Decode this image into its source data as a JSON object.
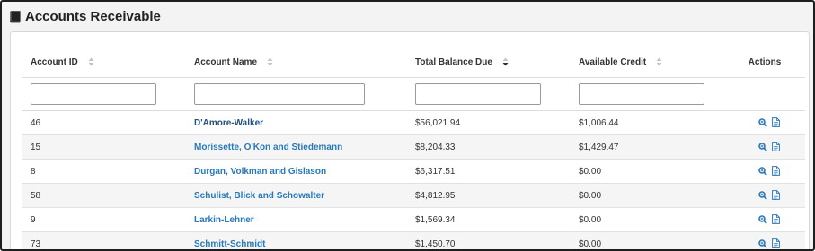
{
  "header": {
    "title": "Accounts Receivable",
    "icon": "book-icon"
  },
  "table": {
    "columns": [
      {
        "label": "Account ID",
        "sort": "unsorted"
      },
      {
        "label": "Account Name",
        "sort": "unsorted"
      },
      {
        "label": "Total Balance Due",
        "sort": "descending"
      },
      {
        "label": "Available Credit",
        "sort": "unsorted"
      },
      {
        "label": "Actions",
        "sort": "none"
      }
    ],
    "filters": {
      "account_id": "",
      "account_name": "",
      "total_balance_due": "",
      "available_credit": ""
    },
    "rows": [
      {
        "id": "46",
        "name": "D'Amore-Walker",
        "balance": "$56,021.94",
        "credit": "$1,006.44"
      },
      {
        "id": "15",
        "name": "Morissette, O'Kon and Stiedemann",
        "balance": "$8,204.33",
        "credit": "$1,429.47"
      },
      {
        "id": "8",
        "name": "Durgan, Volkman and Gislason",
        "balance": "$6,317.51",
        "credit": "$0.00"
      },
      {
        "id": "58",
        "name": "Schulist, Blick and Schowalter",
        "balance": "$4,812.95",
        "credit": "$0.00"
      },
      {
        "id": "9",
        "name": "Larkin-Lehner",
        "balance": "$1,569.34",
        "credit": "$0.00"
      },
      {
        "id": "73",
        "name": "Schmitt-Schmidt",
        "balance": "$1,450.70",
        "credit": "$0.00"
      }
    ],
    "row_actions": [
      "view-icon",
      "document-icon"
    ]
  },
  "colors": {
    "link": "#2a78b8",
    "link_visited": "#22527f",
    "icon": "#2a78b8",
    "stripe": "#f5f5f5",
    "border": "#dcdcdc"
  }
}
